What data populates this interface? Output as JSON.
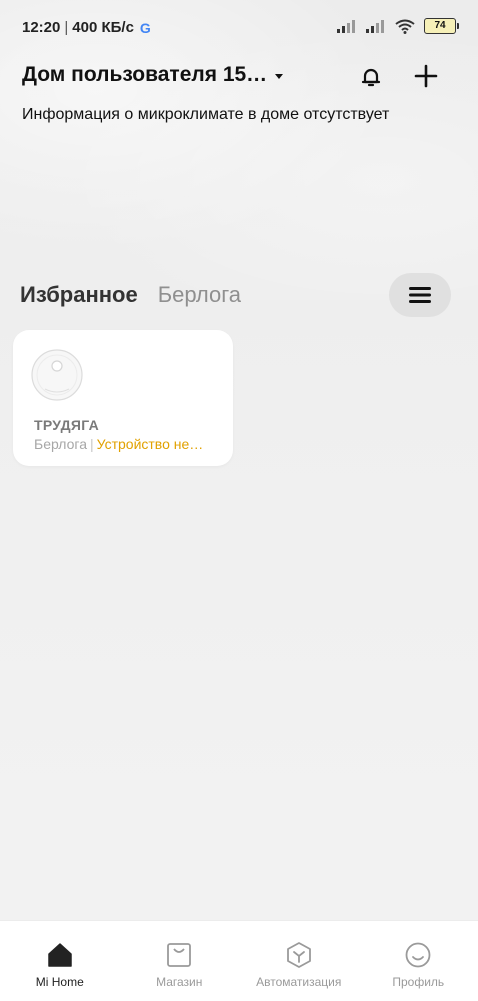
{
  "status_bar": {
    "time": "12:20",
    "separator": "|",
    "speed": "400 КБ/с",
    "google_glyph": "G",
    "battery": "74"
  },
  "header": {
    "home_name": "Дом пользователя 15…",
    "climate_info": "Информация о микроклимате в доме отсутствует"
  },
  "tabs": [
    {
      "label": "Избранное",
      "active": true
    },
    {
      "label": "Берлога",
      "active": false
    }
  ],
  "devices": [
    {
      "name": "ТРУДЯГА",
      "room": "Берлога",
      "divider": "|",
      "status": "Устройство не…",
      "icon": "robot-vacuum-icon"
    }
  ],
  "bottom_nav": [
    {
      "label": "Mi Home",
      "icon": "home-icon",
      "active": true
    },
    {
      "label": "Магазин",
      "icon": "shop-bag-icon",
      "active": false
    },
    {
      "label": "Автоматизация",
      "icon": "automation-cube-icon",
      "active": false
    },
    {
      "label": "Профиль",
      "icon": "profile-smile-icon",
      "active": false
    }
  ],
  "colors": {
    "accent_status": "#e1a100",
    "active_text": "#222222",
    "inactive_text": "#9a9a9a"
  }
}
